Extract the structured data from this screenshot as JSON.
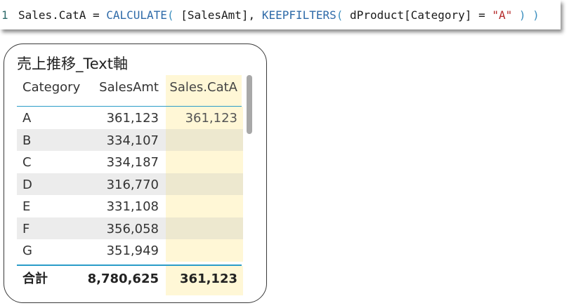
{
  "formula": {
    "line_number": "1",
    "measure_name": "Sales.CatA",
    "equals": " = ",
    "fn_calculate": "CALCULATE",
    "open1": "(",
    "arg1": " [SalesAmt]",
    "comma": ", ",
    "fn_keepfilters": "KEEPFILTERS",
    "open2": "(",
    "arg2": " dProduct[Category] = ",
    "string": "\"A\"",
    "close2": " )",
    "close1": " )"
  },
  "visual": {
    "title": "売上推移_Text軸",
    "columns": [
      "Category",
      "SalesAmt",
      "Sales.CatA"
    ],
    "rows": [
      {
        "category": "A",
        "sales_amt": "361,123",
        "sales_cata": "361,123"
      },
      {
        "category": "B",
        "sales_amt": "334,107",
        "sales_cata": ""
      },
      {
        "category": "C",
        "sales_amt": "334,187",
        "sales_cata": ""
      },
      {
        "category": "D",
        "sales_amt": "316,770",
        "sales_cata": ""
      },
      {
        "category": "E",
        "sales_amt": "331,108",
        "sales_cata": ""
      },
      {
        "category": "F",
        "sales_amt": "356,058",
        "sales_cata": ""
      },
      {
        "category": "G",
        "sales_amt": "351,949",
        "sales_cata": ""
      }
    ],
    "total": {
      "label": "合計",
      "sales_amt": "8,780,625",
      "sales_cata": "361,123"
    }
  },
  "colors": {
    "highlight_column": "#fff7d6",
    "header_rule": "#2a9cc8",
    "function": "#2e6aa8",
    "string": "#b52a2a"
  }
}
